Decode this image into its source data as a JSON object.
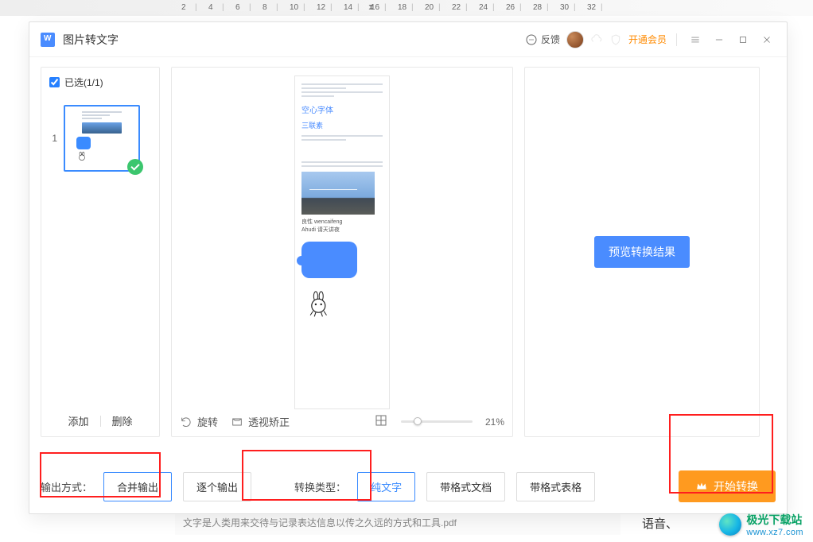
{
  "ruler": {
    "ticks": [
      "2",
      "4",
      "6",
      "8",
      "10",
      "12",
      "14",
      "16",
      "18",
      "20",
      "22",
      "24",
      "26",
      "28",
      "30",
      "32"
    ]
  },
  "titlebar": {
    "title": "图片转文字",
    "feedback": "反馈",
    "vip": "开通会员"
  },
  "left": {
    "selected_label": "已选(1/1)",
    "thumb_index": "1",
    "add": "添加",
    "delete": "删除"
  },
  "mid": {
    "heading": "空心字体",
    "sub_label": "三联素",
    "caption1": "良性 wencaifeng",
    "caption2": "Ahudi 请天讲夜",
    "rotate": "旋转",
    "perspective": "透视矫正",
    "zoom": "21%"
  },
  "right": {
    "preview_btn": "预览转换结果"
  },
  "footer": {
    "output_label": "输出方式：",
    "merge": "合并输出",
    "per_page": "逐个输出",
    "type_label": "转换类型：",
    "plain": "纯文字",
    "doc_fmt": "带格式文档",
    "table_fmt": "带格式表格",
    "start": "开始转换"
  },
  "background": {
    "strip": "文字是人类用来交待与记录表达信息以传之久远的方式和工具.pdf",
    "right": "语音、"
  },
  "watermark": {
    "line1": "极光下载站",
    "line2": "www.xz7.com"
  }
}
